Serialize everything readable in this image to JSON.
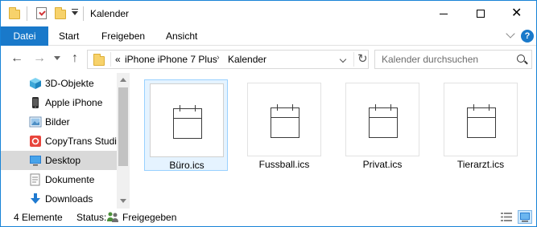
{
  "window": {
    "title": "Kalender",
    "controls": {
      "minimize": "—",
      "maximize": "☐",
      "close": "✕"
    }
  },
  "quick_access": {
    "icons": [
      "folder-icon",
      "properties-icon",
      "new-folder-icon",
      "customize-dropdown-icon"
    ]
  },
  "ribbon": {
    "tabs": [
      {
        "label": "Datei",
        "active": true
      },
      {
        "label": "Start"
      },
      {
        "label": "Freigeben"
      },
      {
        "label": "Ansicht"
      }
    ],
    "help": "?"
  },
  "navigation": {
    "back": "←",
    "forward": "→",
    "up": "↑",
    "overflow": "«",
    "breadcrumb": [
      "iPhone iPhone 7 Plus",
      "Kalender"
    ],
    "crumb_separator": "›",
    "refresh": "↻"
  },
  "search": {
    "placeholder": "Kalender durchsuchen"
  },
  "nav_pane": {
    "items": [
      {
        "label": "3D-Objekte",
        "icon": "cube-icon",
        "state": "normal"
      },
      {
        "label": "Apple iPhone",
        "icon": "phone-icon",
        "state": "normal"
      },
      {
        "label": "Bilder",
        "icon": "pictures-icon",
        "state": "normal"
      },
      {
        "label": "CopyTrans Studio",
        "icon": "copytrans-icon",
        "state": "normal"
      },
      {
        "label": "Desktop",
        "icon": "desktop-icon",
        "state": "hover"
      },
      {
        "label": "Dokumente",
        "icon": "documents-icon",
        "state": "normal"
      },
      {
        "label": "Downloads",
        "icon": "download-icon",
        "state": "normal"
      }
    ]
  },
  "files": [
    {
      "name": "Büro.ics",
      "selected": true
    },
    {
      "name": "Fussball.ics",
      "selected": false
    },
    {
      "name": "Privat.ics",
      "selected": false
    },
    {
      "name": "Tierarzt.ics",
      "selected": false
    }
  ],
  "status": {
    "count": "4 Elemente",
    "label": "Status:",
    "value": "Freigegeben"
  },
  "colors": {
    "accent": "#1979ca",
    "selection": "#cce8ff",
    "hover": "#d9d9d9"
  }
}
